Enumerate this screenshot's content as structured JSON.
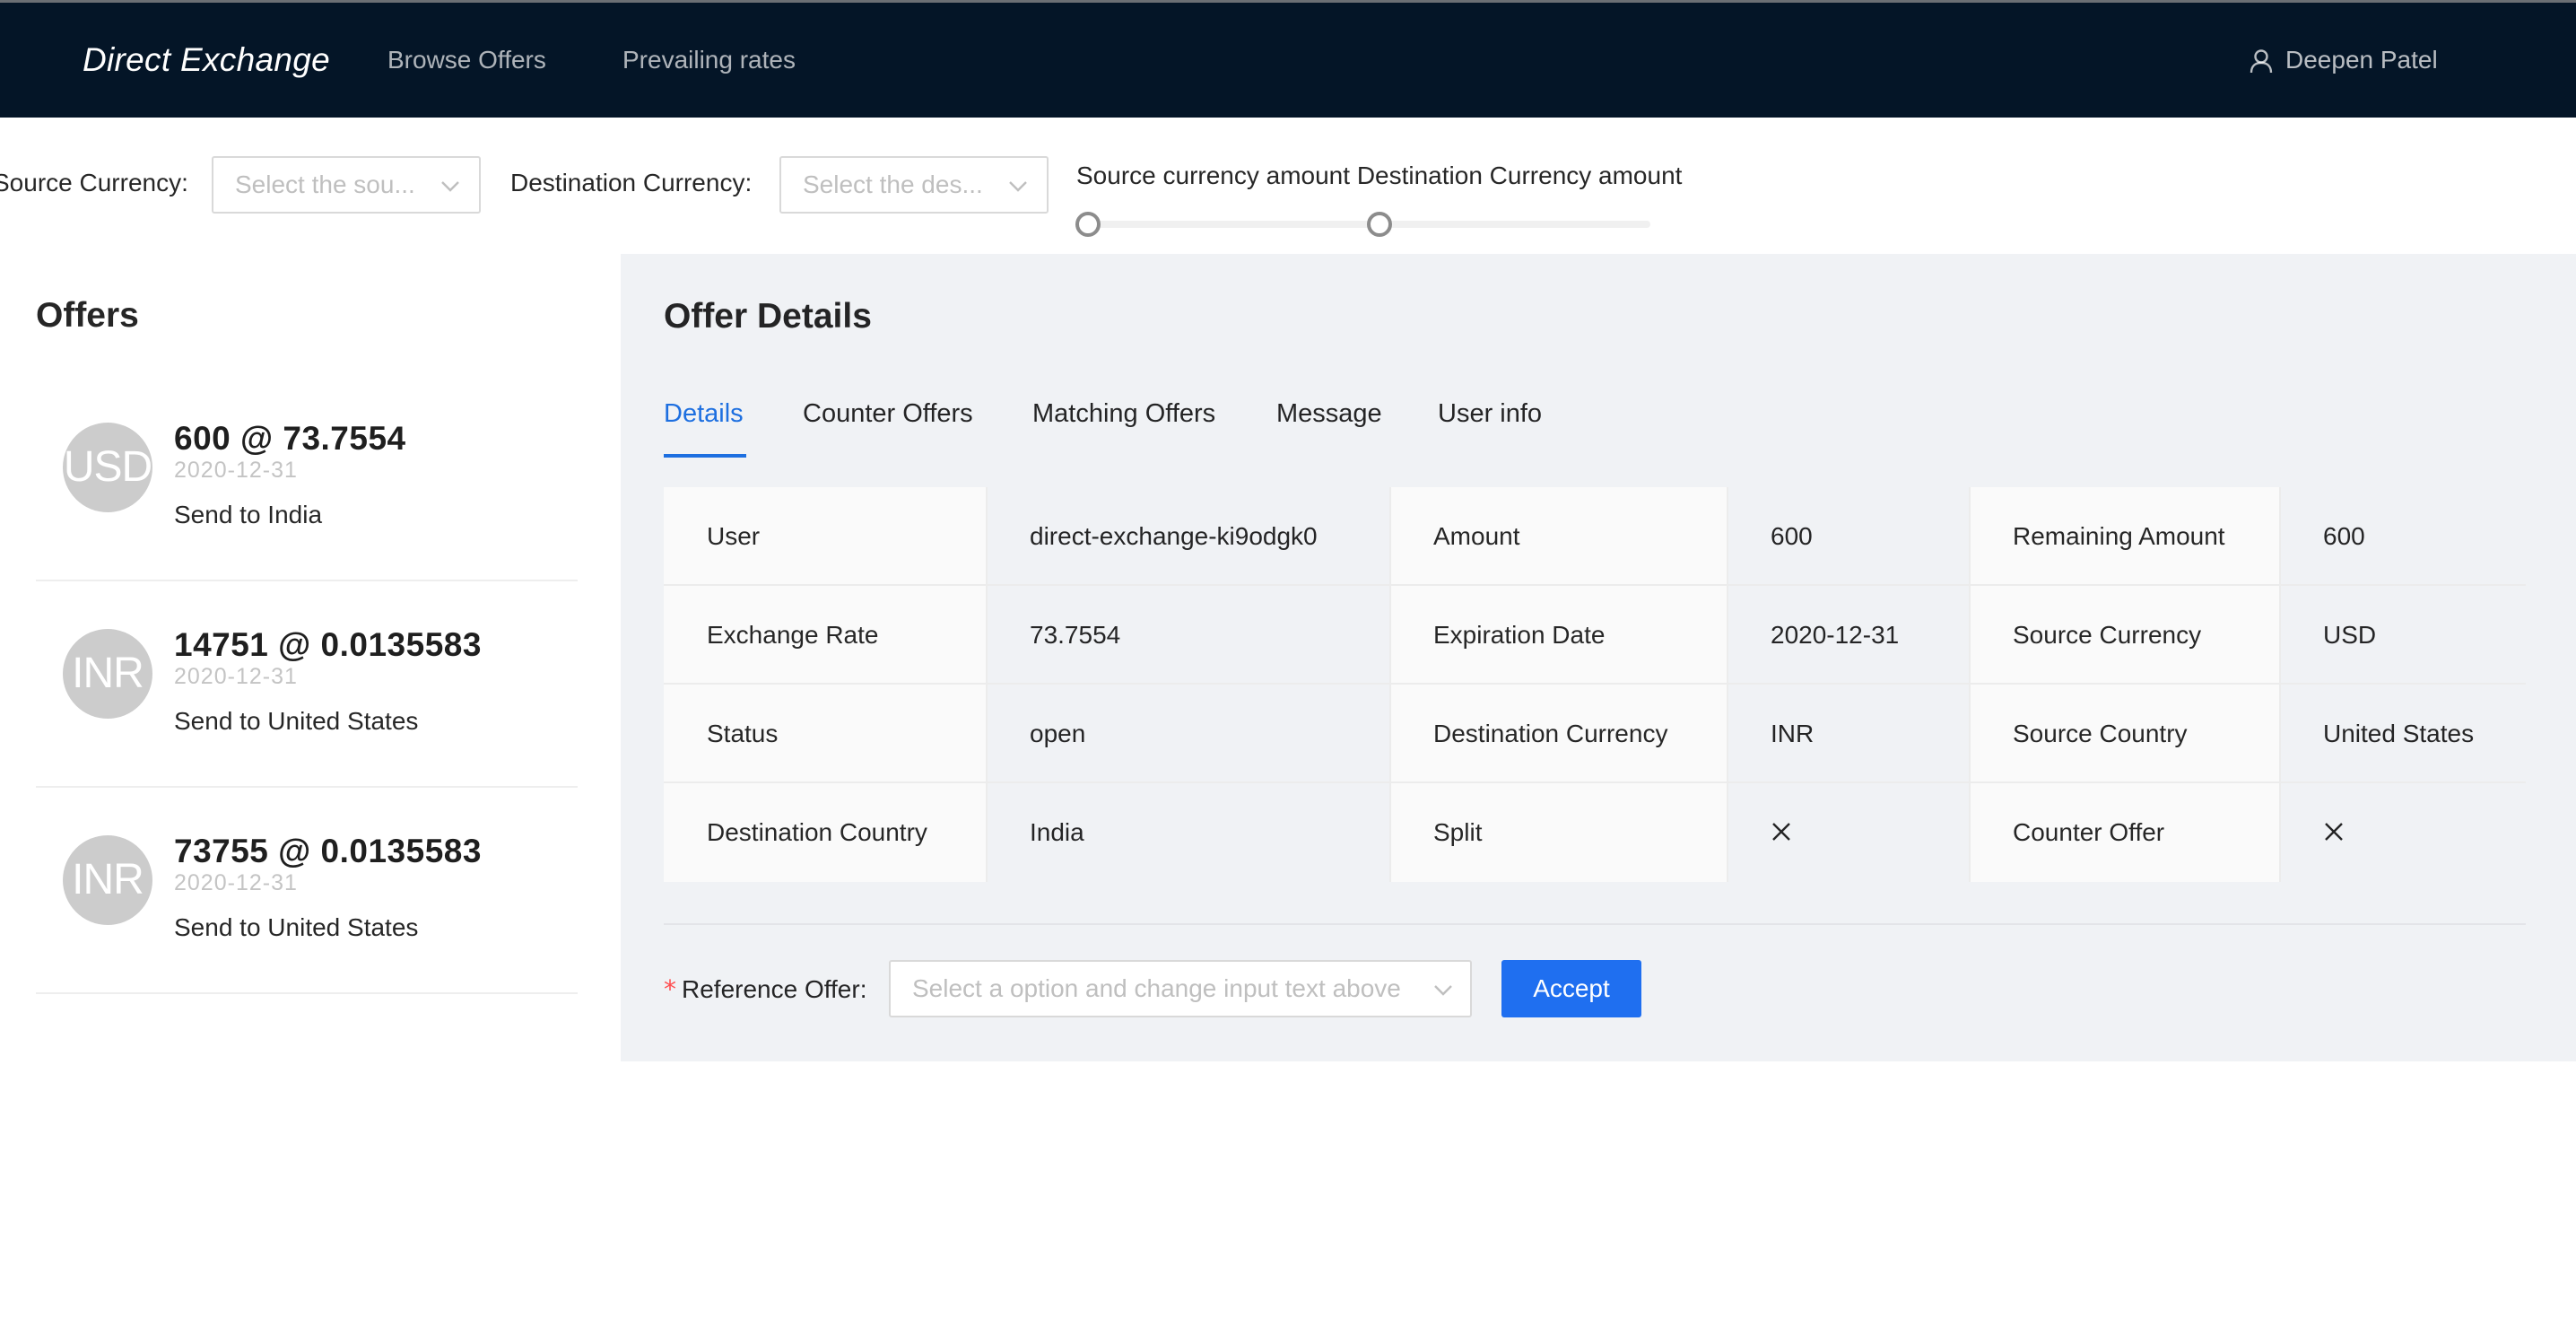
{
  "header": {
    "brand": "Direct Exchange",
    "nav": [
      {
        "label": "Browse Offers"
      },
      {
        "label": "Prevailing rates"
      }
    ],
    "user": {
      "name": "Deepen Patel",
      "icon": "user-icon"
    }
  },
  "filters": {
    "source_currency_label": "Source Currency",
    "source_currency_placeholder": "Select the sou...",
    "destination_currency_label": "Destination Currency",
    "destination_currency_placeholder": "Select the des...",
    "amount_label": "Source currency amount Destination Currency amount"
  },
  "offers": {
    "title": "Offers",
    "items": [
      {
        "avatar": "USD",
        "title": "600 @ 73.7554",
        "date": "2020-12-31",
        "desc": "Send to India"
      },
      {
        "avatar": "INR",
        "title": "14751 @ 0.0135583",
        "date": "2020-12-31",
        "desc": "Send to United States"
      },
      {
        "avatar": "INR",
        "title": "73755 @ 0.0135583",
        "date": "2020-12-31",
        "desc": "Send to United States"
      }
    ]
  },
  "details": {
    "title": "Offer Details",
    "tabs": [
      {
        "label": "Details",
        "active": true
      },
      {
        "label": "Counter Offers"
      },
      {
        "label": "Matching Offers"
      },
      {
        "label": "Message"
      },
      {
        "label": "User info"
      }
    ],
    "rows": [
      [
        {
          "label": "User",
          "value": "direct-exchange-ki9odgk0"
        },
        {
          "label": "Amount",
          "value": "600"
        },
        {
          "label": "Remaining Amount",
          "value": "600"
        }
      ],
      [
        {
          "label": "Exchange Rate",
          "value": "73.7554"
        },
        {
          "label": "Expiration Date",
          "value": "2020-12-31"
        },
        {
          "label": "Source Currency",
          "value": "USD"
        }
      ],
      [
        {
          "label": "Status",
          "value": "open"
        },
        {
          "label": "Destination Currency",
          "value": "INR"
        },
        {
          "label": "Source Country",
          "value": "United States"
        }
      ],
      [
        {
          "label": "Destination Country",
          "value": "India"
        },
        {
          "label": "Split",
          "value_icon": "close-icon"
        },
        {
          "label": "Counter Offer",
          "value_icon": "close-icon"
        }
      ]
    ],
    "reference_offer_label": "Reference Offer",
    "reference_offer_placeholder": "Select a option and change input text above",
    "accept_label": "Accept"
  },
  "colors": {
    "header_bg": "#041527",
    "primary": "#1f6ff0",
    "panel_bg": "#f0f2f5",
    "label_cell_bg": "#fafafa",
    "avatar_bg": "#cccccc",
    "required_mark": "#ff4d4f"
  }
}
